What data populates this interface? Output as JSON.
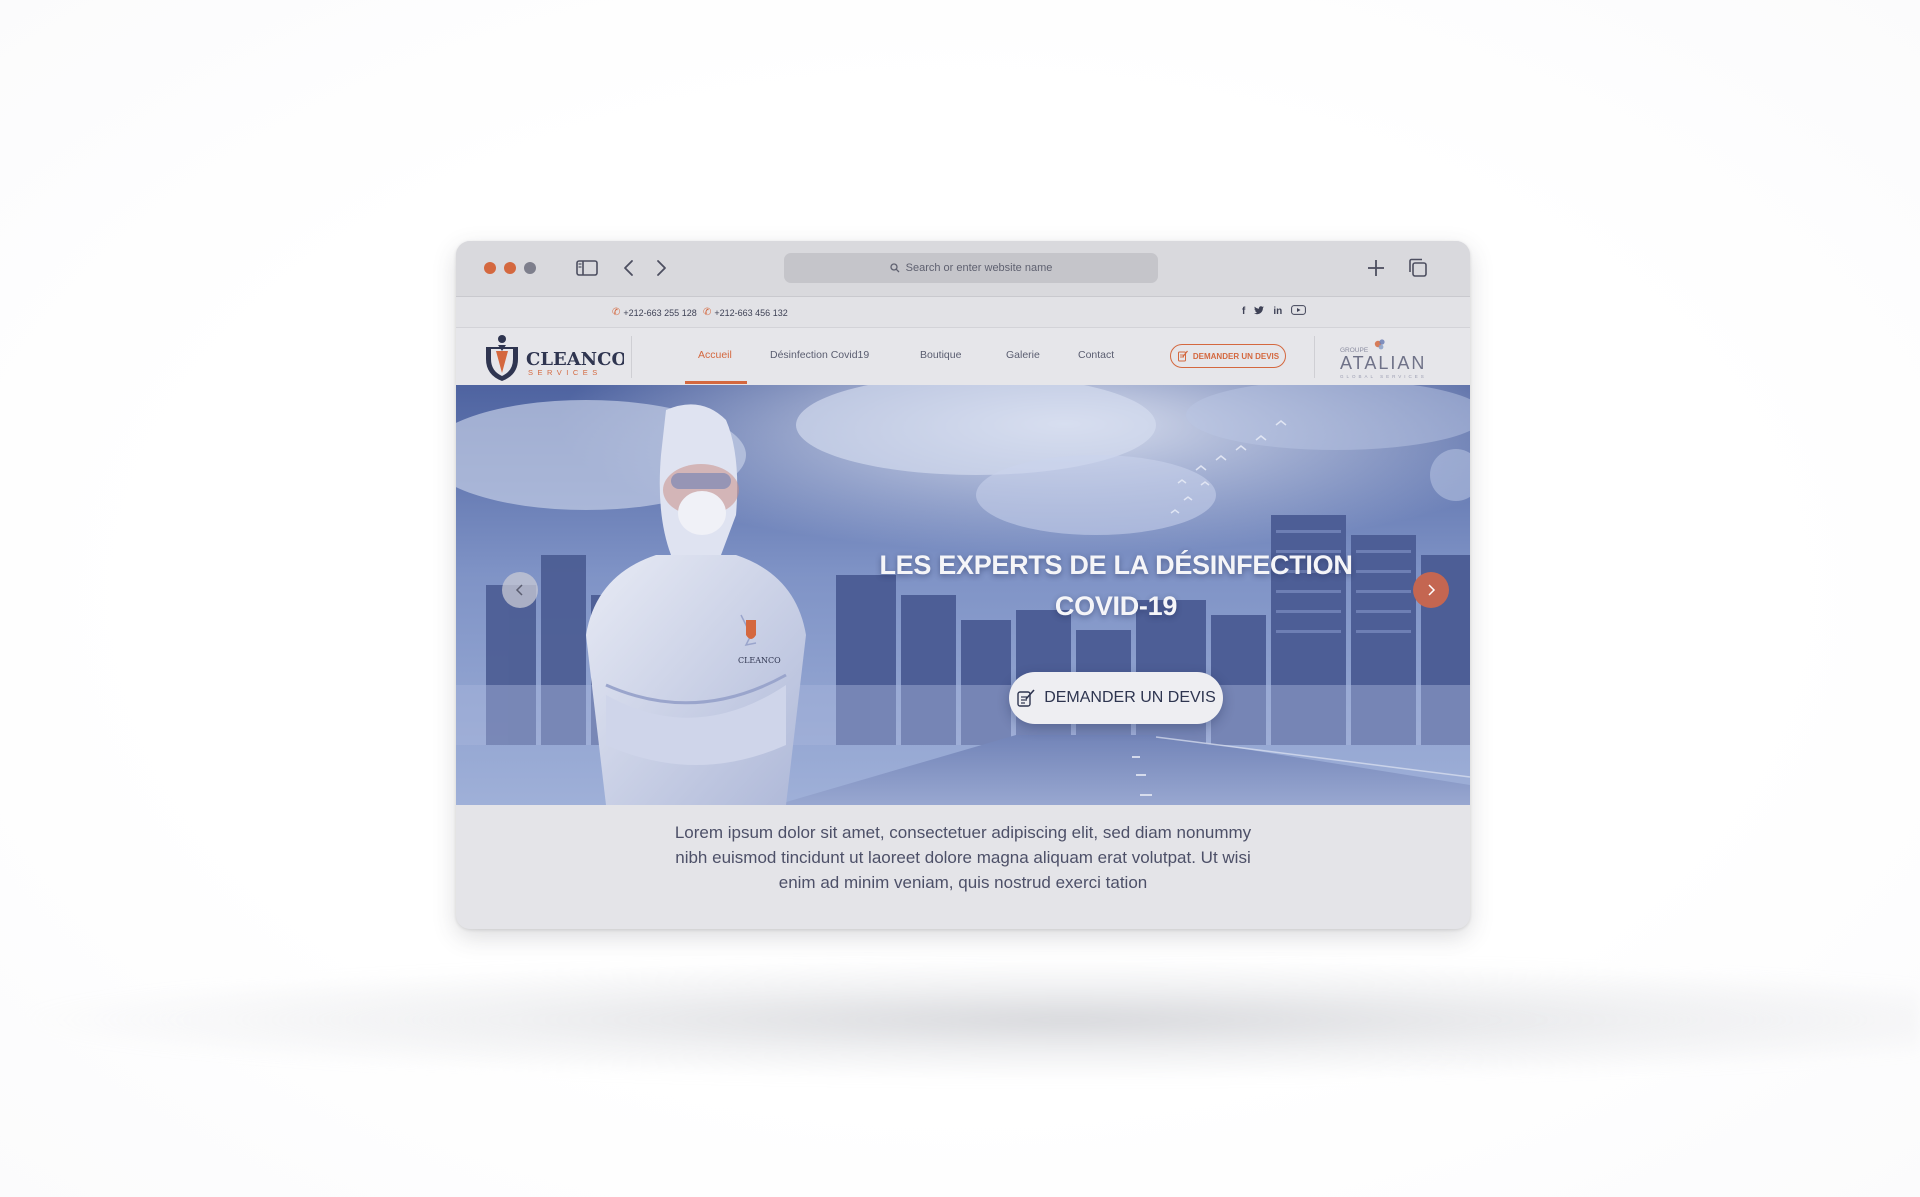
{
  "browser": {
    "address_placeholder": "Search or enter website name",
    "icons": [
      "sidebar-icon",
      "chevron-left-icon",
      "chevron-right-icon",
      "search-icon",
      "plus-icon",
      "tabs-icon"
    ]
  },
  "topbar": {
    "phone_1": "+212-663 255 128",
    "phone_2": "+212-663 456 132",
    "socials": [
      "facebook-icon",
      "twitter-icon",
      "linkedin-icon",
      "youtube-icon"
    ]
  },
  "nav": {
    "logo_primary": "CLEANCO",
    "logo_secondary": "SERVICES",
    "items": [
      {
        "label": "Accueil",
        "active": true
      },
      {
        "label": "Désinfection Covid19",
        "active": false
      },
      {
        "label": "Boutique",
        "active": false
      },
      {
        "label": "Galerie",
        "active": false
      },
      {
        "label": "Contact",
        "active": false
      }
    ],
    "cta_label": "DEMANDER UN DEVIS",
    "partner_prefix": "GROUPE",
    "partner_name": "ATALIAN",
    "partner_tagline": "GLOBAL SERVICES"
  },
  "hero": {
    "title_line_1": "LES EXPERTS DE LA DÉSINFECTION",
    "title_line_2": "COVID-19",
    "cta_label": "DEMANDER UN DEVIS",
    "suit_logo_text": "CLEANCO"
  },
  "intro": {
    "text": "Lorem ipsum dolor sit amet, consectetuer adipiscing elit, sed diam nonummy nibh euismod tincidunt ut laoreet dolore magna aliquam erat volutpat. Ut wisi enim ad minim veniam, quis nostrud exerci tation"
  },
  "colors": {
    "accent": "#d4683f",
    "navy": "#3f4256",
    "hero_tint": "#6d7fb5"
  }
}
